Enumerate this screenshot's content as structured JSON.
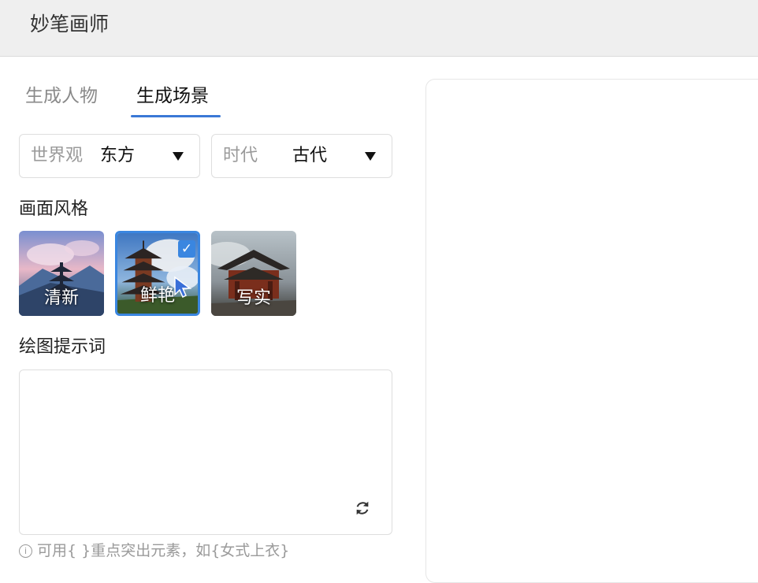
{
  "header": {
    "title": "妙笔画师"
  },
  "tabs": [
    {
      "label": "生成人物",
      "active": false
    },
    {
      "label": "生成场景",
      "active": true
    }
  ],
  "filters": {
    "worldview": {
      "label": "世界观",
      "value": "东方"
    },
    "era": {
      "label": "时代",
      "value": "古代"
    }
  },
  "style": {
    "section_label": "画面风格",
    "options": [
      {
        "label": "清新",
        "selected": false
      },
      {
        "label": "鲜艳",
        "selected": true
      },
      {
        "label": "写实",
        "selected": false
      }
    ]
  },
  "prompt": {
    "section_label": "绘图提示词",
    "value": "",
    "hint": "可用{ }重点突出元素，如{女式上衣}"
  },
  "colors": {
    "accent": "#3a86e0",
    "tab_underline": "#3a78d6"
  },
  "icons": [
    "chevron-down-icon",
    "checkmark-icon",
    "refresh-icon",
    "info-icon",
    "mouse-cursor-icon"
  ]
}
